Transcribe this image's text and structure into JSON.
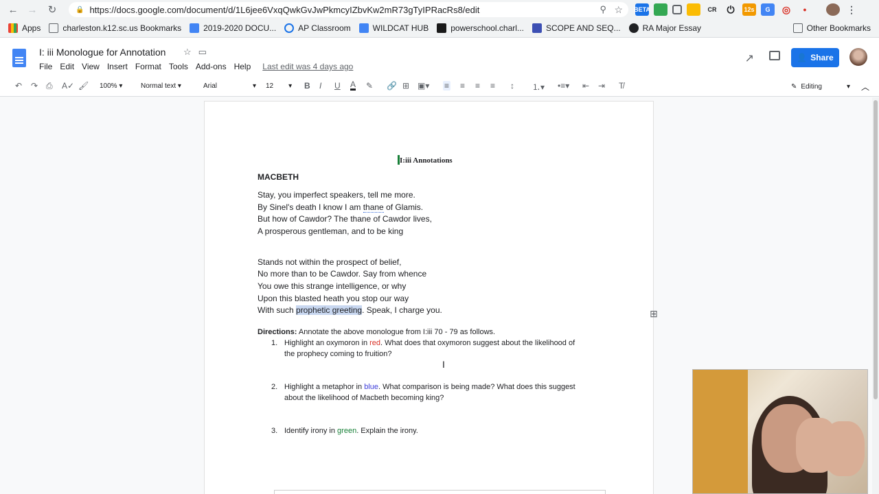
{
  "browser": {
    "url": "https://docs.google.com/document/d/1L6jee6VxqQwkGvJwPkmcyIZbvKw2mR73gTyIPRacRs8/edit",
    "extensions": [
      "BETA",
      "CR",
      "12s"
    ]
  },
  "bookmarks": [
    {
      "label": "Apps",
      "color": "#4285f4"
    },
    {
      "label": "charleston.k12.sc.us Bookmarks",
      "color": "#5f6368"
    },
    {
      "label": "2019-2020 DOCU...",
      "color": "#4285f4"
    },
    {
      "label": "AP Classroom",
      "color": "#1a73e8"
    },
    {
      "label": "WILDCAT HUB",
      "color": "#4285f4"
    },
    {
      "label": "powerschool.charl...",
      "color": "#1a1a1a"
    },
    {
      "label": "SCOPE AND SEQ...",
      "color": "#3c4fb3"
    },
    {
      "label": "RA Major Essay",
      "color": "#202124"
    }
  ],
  "other_bookmarks": "Other Bookmarks",
  "doc": {
    "title": "I: iii Monologue for Annotation",
    "menu": [
      "File",
      "Edit",
      "View",
      "Insert",
      "Format",
      "Tools",
      "Add-ons",
      "Help"
    ],
    "last_edit": "Last edit was 4 days ago",
    "share_label": "Share"
  },
  "toolbar": {
    "zoom": "100%",
    "style": "Normal text",
    "font": "Arial",
    "size": "12",
    "mode": "Editing"
  },
  "content": {
    "heading": "I:iii Annotations",
    "speaker": "MACBETH",
    "stanza1": [
      "Stay, you imperfect speakers, tell me more.",
      "By Sinel's death I know I am thane of Glamis.",
      "But how of Cawdor? The thane of Cawdor lives,",
      "A prosperous gentleman, and to be king"
    ],
    "stanza2": [
      "Stands not within the prospect of belief,",
      "No more than to be Cawdor. Say from whence",
      "You owe this strange intelligence, or why",
      "Upon this blasted heath you stop our way"
    ],
    "last_line_pre": "With such ",
    "last_line_highlight": "prophetic greeting",
    "last_line_post": ". Speak, I charge you.",
    "line2_pre": "By Sinel's death I know I am ",
    "line2_word": "thane",
    "line2_post": " of Glamis.",
    "directions_label": "Directions:",
    "directions_text": " Annotate the above monologue from I:iii 70 - 79 as follows.",
    "items": [
      {
        "num": "1.",
        "pre": "Highlight an oxymoron in ",
        "color_word": "red",
        "post": ". What does that oxymoron suggest about the likelihood of",
        "line2": "the prophecy coming to fruition?"
      },
      {
        "num": "2.",
        "pre": "Highlight a metaphor in ",
        "color_word": "blue",
        "post": ". What comparison is being made? What does this suggest",
        "line2": "about the likelihood of Macbeth becoming king?"
      },
      {
        "num": "3.",
        "pre": "Identify irony in ",
        "color_word": "green",
        "post": ". Explain the irony.",
        "line2": ""
      }
    ]
  },
  "colors": {
    "accent": "#1a73e8",
    "red": "#d93025",
    "blue": "#3c3cd9",
    "green": "#188038"
  }
}
